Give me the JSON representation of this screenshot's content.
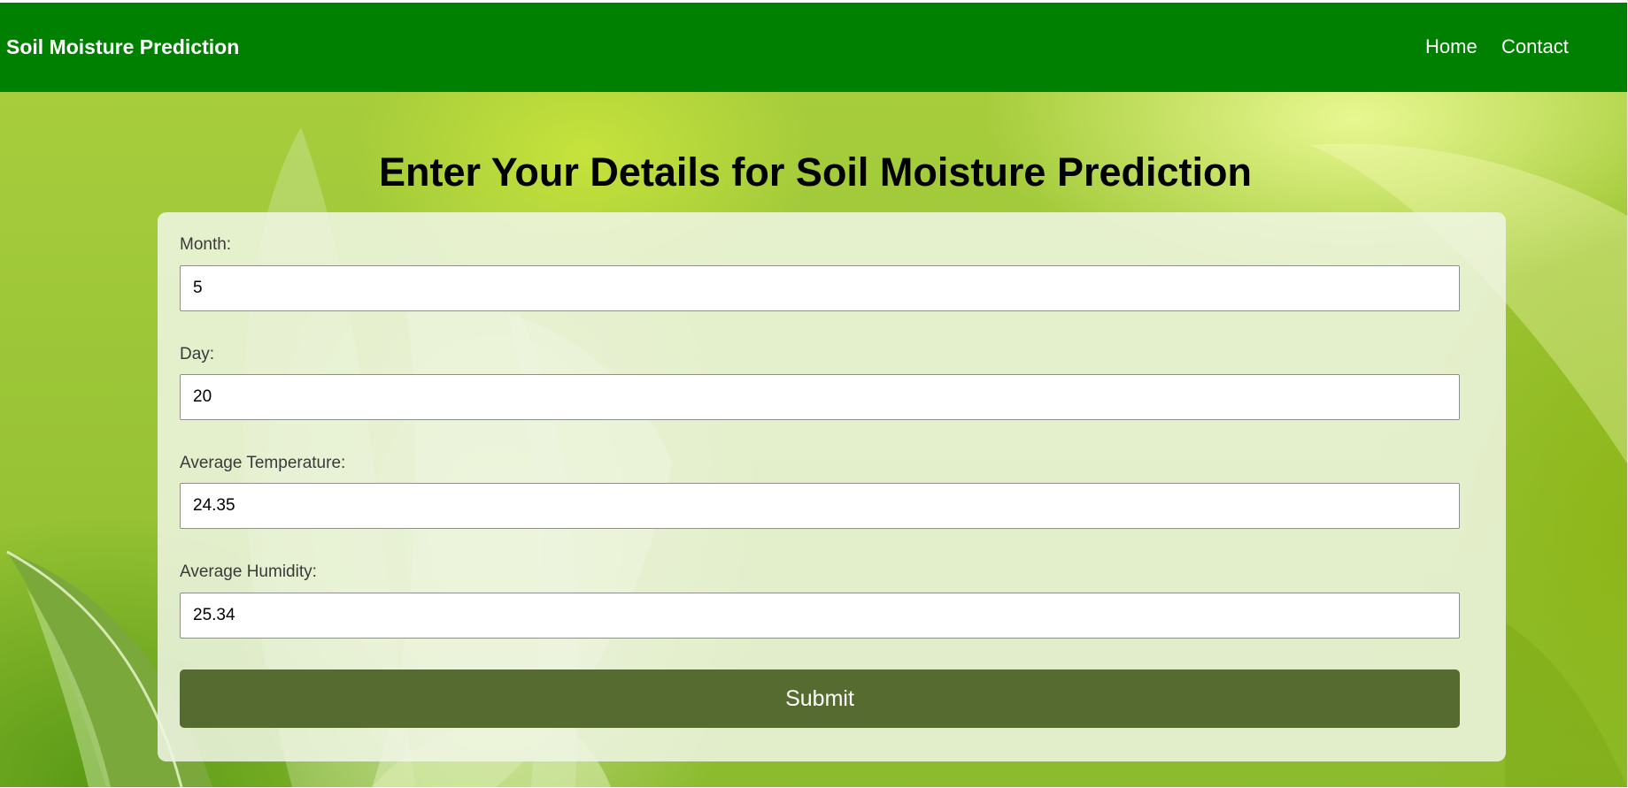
{
  "navbar": {
    "brand": "Soil Moisture Prediction",
    "links": [
      "Home",
      "Contact"
    ],
    "background_color": "#008000"
  },
  "main": {
    "heading": "Enter Your Details for Soil Moisture Prediction",
    "fields": [
      {
        "label": "Month:",
        "value": "5"
      },
      {
        "label": "Day:",
        "value": "20"
      },
      {
        "label": "Average Temperature:",
        "value": "24.35"
      },
      {
        "label": "Average Humidity:",
        "value": "25.34"
      }
    ],
    "submit_label": "Submit",
    "submit_color": "#556b2f"
  }
}
